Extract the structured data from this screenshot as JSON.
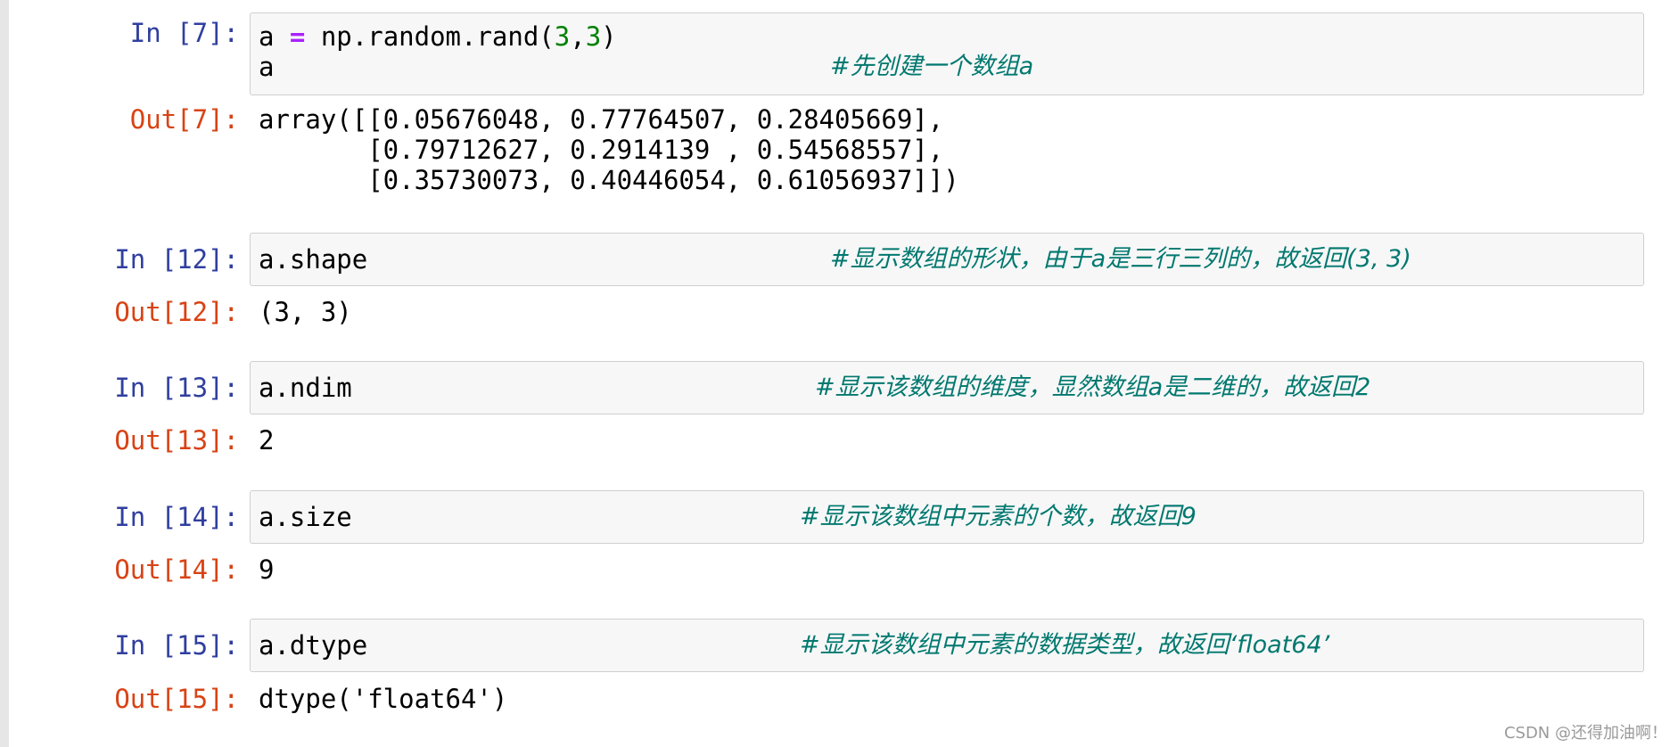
{
  "cells": [
    {
      "in_prompt": "In [7]:",
      "code_lines": [
        "a = np.random.rand(3,3)",
        "a"
      ],
      "code_parts": {
        "a": "a ",
        "eq": "=",
        "mid": " np.random.rand(",
        "n1": "3",
        "comma": ",",
        "n2": "3",
        "close": ")"
      },
      "comment": "#先创建一个数组a",
      "out_prompt": "Out[7]:",
      "output_lines": [
        "array([[0.05676048, 0.77764507, 0.28405669],",
        "       [0.79712627, 0.2914139 , 0.54568557],",
        "       [0.35730073, 0.40446054, 0.61056937]])"
      ]
    },
    {
      "in_prompt": "In [12]:",
      "code": "a.shape",
      "comment": "#显示数组的形状，由于a是三行三列的，故返回(3, 3)",
      "out_prompt": "Out[12]:",
      "output": "(3, 3)"
    },
    {
      "in_prompt": "In [13]:",
      "code": "a.ndim",
      "comment": "#显示该数组的维度，显然数组a是二维的，故返回2",
      "out_prompt": "Out[13]:",
      "output": "2"
    },
    {
      "in_prompt": "In [14]:",
      "code": "a.size",
      "comment": "#显示该数组中元素的个数，故返回9",
      "out_prompt": "Out[14]:",
      "output": "9"
    },
    {
      "in_prompt": "In [15]:",
      "code": "a.dtype",
      "comment": "#显示该数组中元素的数据类型，故返回‘float64’",
      "out_prompt": "Out[15]:",
      "output": "dtype('float64')"
    }
  ],
  "watermark": "CSDN @还得加油啊！",
  "colors": {
    "in_prompt": "#303f9f",
    "out_prompt": "#d84315",
    "comment": "#00786f",
    "operator": "#aa22ff",
    "number": "#008000",
    "cell_bg": "#f7f7f7",
    "cell_border": "#cfcfcf"
  }
}
